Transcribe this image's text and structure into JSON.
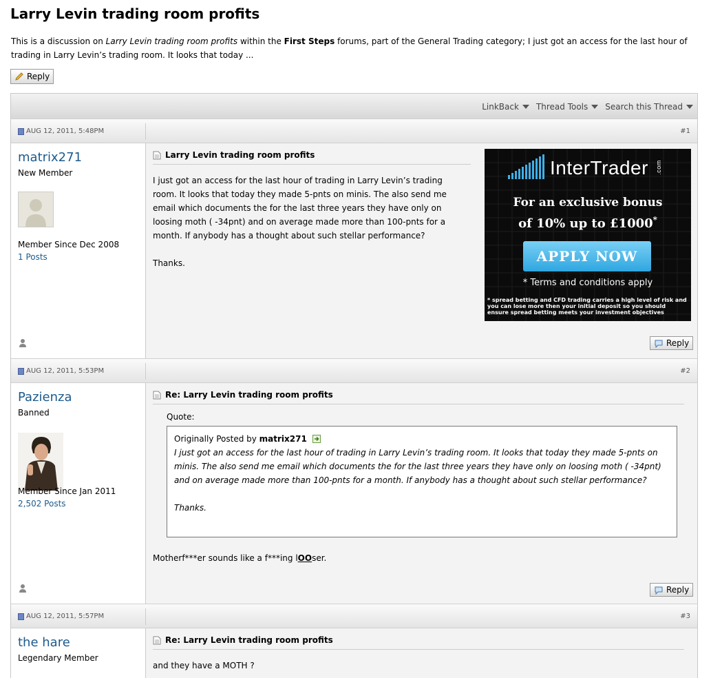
{
  "page": {
    "title": "Larry Levin trading room profits",
    "desc_prefix": "This is a discussion on ",
    "desc_thread": "Larry Levin trading room profits",
    "desc_mid": " within the ",
    "desc_forum": "First Steps",
    "desc_suffix": " forums, part of the General Trading category; I just got an access for the last hour of trading in Larry Levin’s trading room. It looks that today ..."
  },
  "reply_label": "Reply",
  "toolbar": {
    "linkback": "LinkBack",
    "thread_tools": "Thread Tools",
    "search": "Search this Thread"
  },
  "posts": [
    {
      "date": "AUG 12, 2011, 5:48PM",
      "number": "#1",
      "username": "matrix271",
      "user_title": "New Member",
      "since": "Member Since Dec 2008",
      "post_count": "1 Posts",
      "title": "Larry Levin trading room profits",
      "body": "I just got an access for the last hour of trading in Larry Levin’s trading room. It looks that today they made 5-pnts on minis. The also send me email which documents the for the last three years they have only on loosing moth ( -34pnt) and on average made more than 100-pnts for a month. If anybody has a thought about such stellar performance?",
      "signoff": "Thanks."
    },
    {
      "date": "AUG 12, 2011, 5:53PM",
      "number": "#2",
      "username": "Pazienza",
      "user_title": "Banned",
      "since": "Member Since Jan 2011",
      "post_count": "2,502 Posts",
      "title": "Re: Larry Levin trading room profits",
      "quote_label": "Quote:",
      "quote_by_prefix": "Originally Posted by ",
      "quote_author": "matrix271",
      "quote_text": "I just got an access for the last hour of trading in Larry Levin’s trading room. It looks that today they made 5-pnts on minis. The also send me email which documents the for the last three years they have only on loosing moth ( -34pnt) and on average made more than 100-pnts for a month. If anybody has a thought about such stellar performance?",
      "quote_signoff": "Thanks.",
      "body_a": "Motherf***er sounds like a f***ing l",
      "body_b": "OO",
      "body_c": "ser."
    },
    {
      "date": "AUG 12, 2011, 5:57PM",
      "number": "#3",
      "username": "the hare",
      "user_title": "Legendary Member",
      "title": "Re: Larry Levin trading room profits",
      "body": "and they have a MOTH ?"
    }
  ],
  "ad": {
    "brand": "InterTrader",
    "brand_suffix": ".com",
    "line1": "For an exclusive bonus",
    "line2": "of 10% up to £1000",
    "line2_mark": "*",
    "cta": "APPLY NOW",
    "terms": "* Terms and conditions apply",
    "disclaimer": "* spread betting and CFD trading carries a high level of risk and you can lose more then your initial deposit so you should ensure spread betting meets your investment objectives",
    "accent": "#3fb0e8"
  }
}
